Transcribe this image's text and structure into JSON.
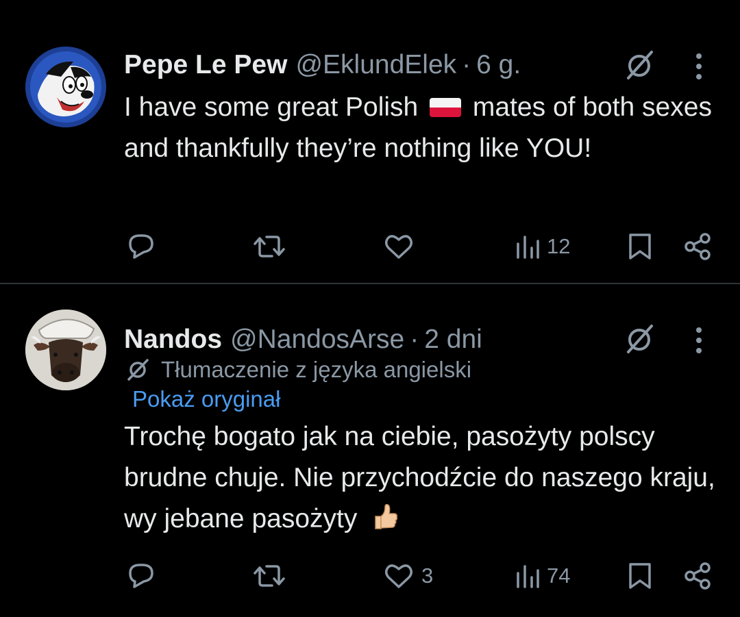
{
  "tweets": [
    {
      "display_name": "Pepe Le Pew",
      "handle": "@EklundElek",
      "separator": "·",
      "time": "6 g.",
      "text_before_flag": "I have some great Polish",
      "flag_icon": "poland-flag-emoji",
      "text_after_flag": " mates of both sexes and thankfully they’re nothing like YOU!",
      "replies": "",
      "reposts": "",
      "likes": "",
      "views": "12"
    },
    {
      "display_name": "Nandos",
      "handle": "@NandosArse",
      "separator": "·",
      "time": "2 dni",
      "translation_note": "Tłumaczenie z języka angielski",
      "show_original": "Pokaż oryginał",
      "text": "Trochę bogato jak na ciebie, pasożyty polscy brudne chuje. Nie przychodźcie do naszego kraju, wy jebane pasożyty",
      "trailing_icon": "thumbs-up-emoji",
      "replies": "",
      "reposts": "",
      "likes": "3",
      "views": "74"
    }
  ],
  "colors": {
    "background": "#000000",
    "text_primary": "#e7e9ea",
    "text_secondary": "#8b98a5",
    "link": "#4a9cf2",
    "divider": "#2f3336"
  },
  "icons": [
    "reply-icon",
    "repost-icon",
    "like-icon",
    "views-icon",
    "bookmark-icon",
    "share-icon",
    "grok-icon",
    "more-icon",
    "translate-icon"
  ]
}
